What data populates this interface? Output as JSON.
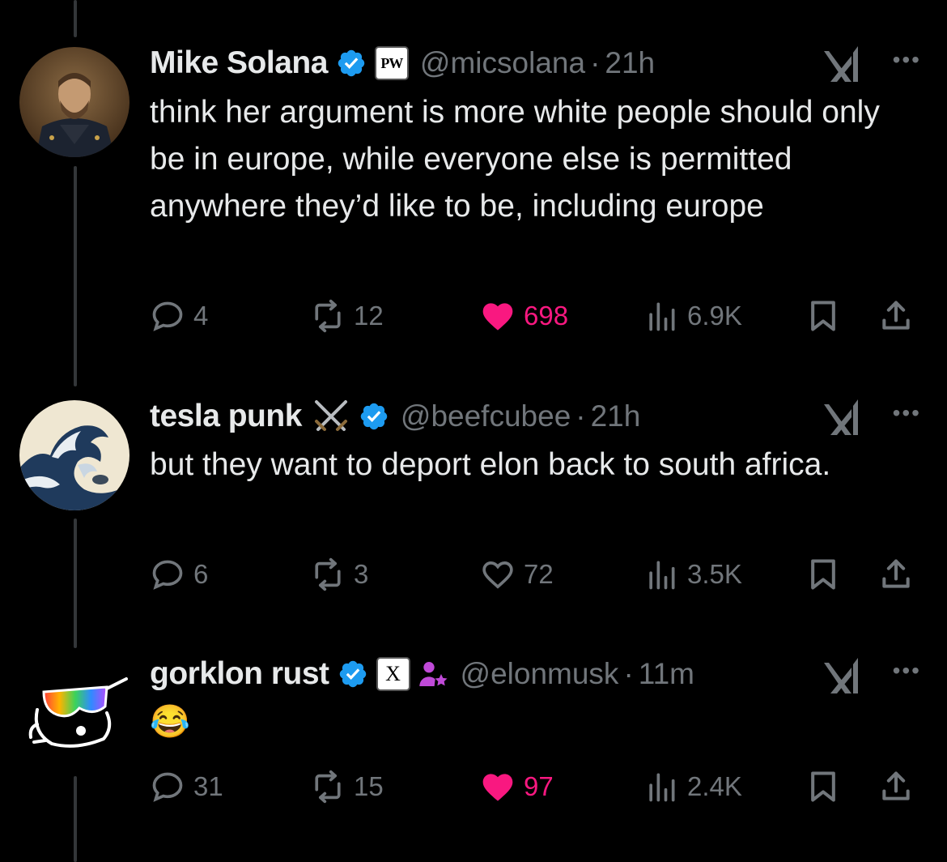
{
  "tweets": [
    {
      "name": "Mike Solana",
      "handle": "@micsolana",
      "time": "21h",
      "affiliate_badge": "PW",
      "text": "think her argument is more white people should only be in europe, while everyone else is permitted anywhere they’d like to be, including europe",
      "replies": "4",
      "reposts": "12",
      "likes": "698",
      "liked": true,
      "views": "6.9K"
    },
    {
      "name": "tesla punk",
      "name_emoji": "⚔️",
      "handle": "@beefcubee",
      "time": "21h",
      "text": "but they want to deport elon back to south africa.",
      "replies": "6",
      "reposts": "3",
      "likes": "72",
      "liked": false,
      "views": "3.5K"
    },
    {
      "name": "gorklon rust",
      "handle": "@elonmusk",
      "time": "11m",
      "affiliate_badge": "X",
      "text": "😂",
      "replies": "31",
      "reposts": "15",
      "likes": "97",
      "liked": true,
      "views": "2.4K"
    }
  ],
  "colors": {
    "background": "#000000",
    "text_primary": "#e7e9ea",
    "text_secondary": "#71767b",
    "verified_blue": "#1d9bf0",
    "like_pink": "#f91880",
    "thread_line": "#333639"
  },
  "icons": [
    "verified-badge-icon",
    "xai-grok-icon",
    "more-icon",
    "reply-icon",
    "repost-icon",
    "like-icon",
    "views-icon",
    "bookmark-icon",
    "share-icon",
    "subscriber-person-star-icon"
  ]
}
